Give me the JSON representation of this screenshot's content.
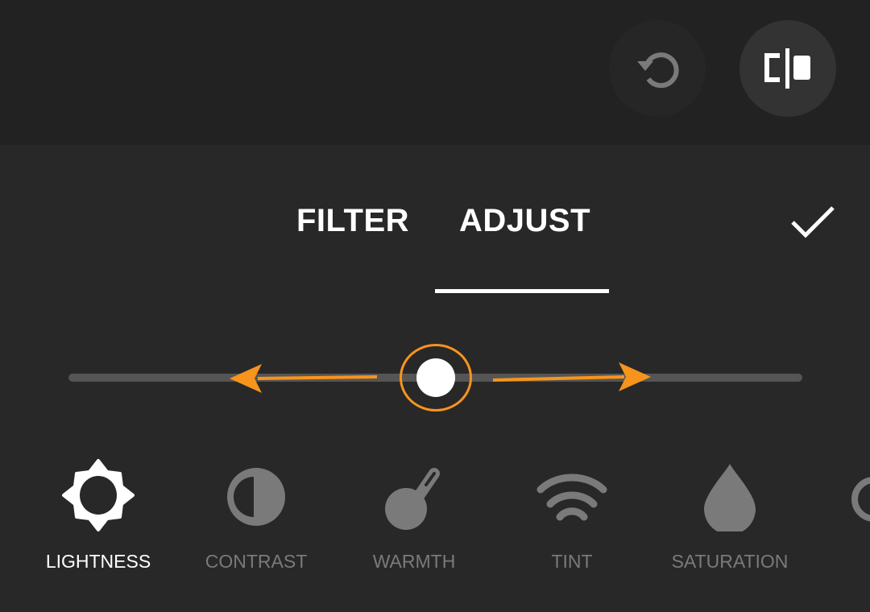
{
  "toolbar": {
    "reset_icon": "reset-rotate-icon",
    "compare_icon": "compare-split-icon"
  },
  "tabs": [
    {
      "label": "FILTER",
      "active": false
    },
    {
      "label": "ADJUST",
      "active": true
    }
  ],
  "confirm_icon": "checkmark-icon",
  "slider": {
    "value": 0.5,
    "accent": "#f7941d"
  },
  "tools": [
    {
      "label": "LIGHTNESS",
      "icon": "sun-icon",
      "active": true
    },
    {
      "label": "CONTRAST",
      "icon": "contrast-icon",
      "active": false
    },
    {
      "label": "WARMTH",
      "icon": "thermometer-icon",
      "active": false
    },
    {
      "label": "TINT",
      "icon": "wifi-arcs-icon",
      "active": false
    },
    {
      "label": "SATURATION",
      "icon": "droplet-icon",
      "active": false
    }
  ]
}
